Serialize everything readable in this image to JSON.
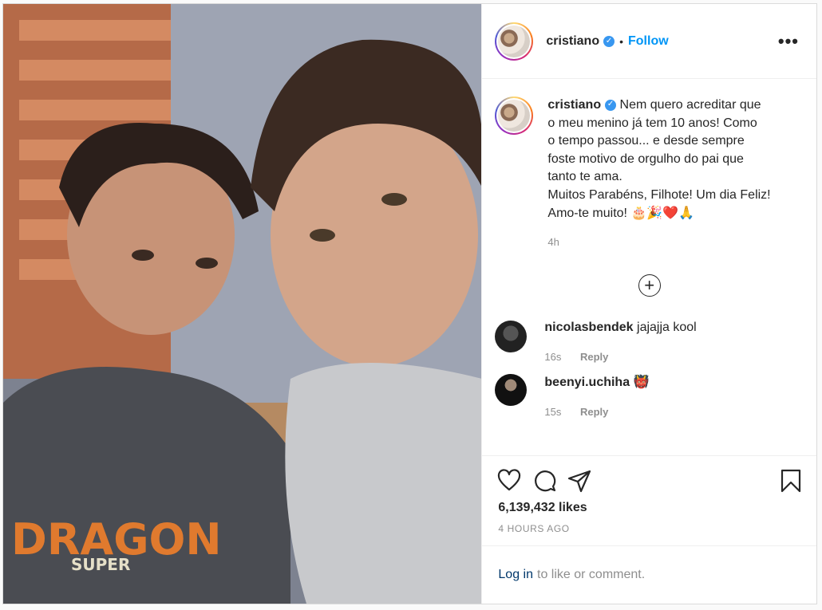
{
  "post": {
    "username": "cristiano",
    "follow_label": "Follow",
    "separator": "•",
    "more_label": "•••",
    "caption_lines": [
      "Nem quero acreditar que",
      "o meu menino já tem 10 anos! Como",
      "o tempo passou... e desde sempre",
      "foste motivo de orgulho do pai que",
      "tanto te ama.",
      "Muitos Parabéns, Filhote! Um dia Feliz!",
      "Amo-te muito! 🎂🎉❤️🙏"
    ],
    "caption_time": "4h",
    "load_more_icon": "plus-circle-icon",
    "comments": [
      {
        "username": "nicolasbendek",
        "text": "jajajja kool",
        "time": "16s",
        "reply": "Reply"
      },
      {
        "username": "beenyi.uchiha",
        "text": "👹",
        "time": "15s",
        "reply": "Reply"
      }
    ],
    "likes": "6,139,432 likes",
    "posted_time": "4 HOURS AGO",
    "login_link": "Log in",
    "login_rest": "to like or comment.",
    "colors": {
      "follow": "#0095f6",
      "link": "#00376b",
      "muted": "#8e8e8e",
      "verified": "#3897f0"
    }
  }
}
